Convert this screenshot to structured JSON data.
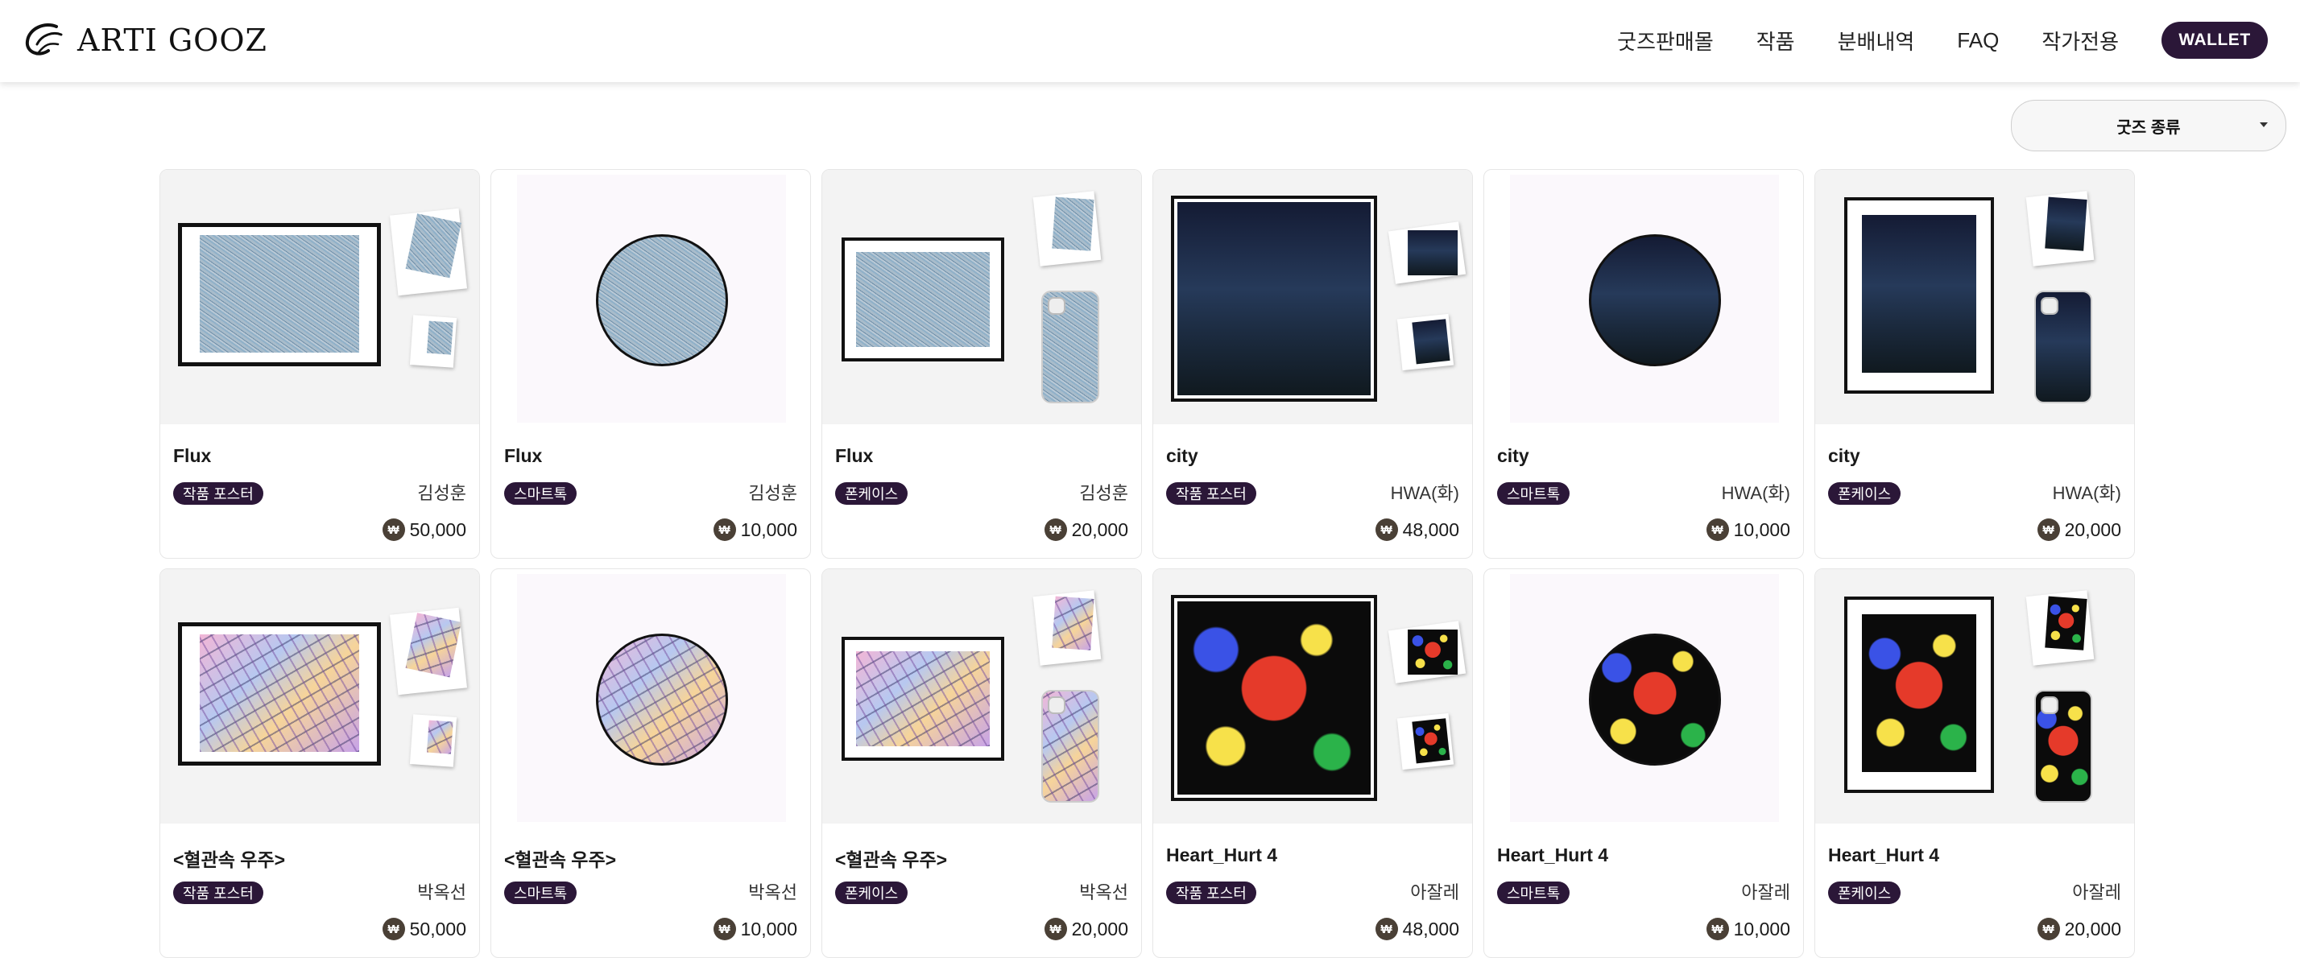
{
  "header": {
    "logo_text": "ARTI GOOZ",
    "nav": [
      "굿즈판매몰",
      "작품",
      "분배내역",
      "FAQ",
      "작가전용"
    ],
    "wallet_label": "WALLET"
  },
  "filter": {
    "selected": "굿즈 종류"
  },
  "currency_symbol": "₩",
  "products": [
    {
      "title": "Flux",
      "type": "작품 포스터",
      "artist": "김성훈",
      "price": "50,000",
      "layout": "poster",
      "art": "flux"
    },
    {
      "title": "Flux",
      "type": "스마트톡",
      "artist": "김성훈",
      "price": "10,000",
      "layout": "griptok",
      "art": "flux"
    },
    {
      "title": "Flux",
      "type": "폰케이스",
      "artist": "김성훈",
      "price": "20,000",
      "layout": "phonecase",
      "art": "flux"
    },
    {
      "title": "city",
      "type": "작품 포스터",
      "artist": "HWA(화)",
      "price": "48,000",
      "layout": "poster-square",
      "art": "city"
    },
    {
      "title": "city",
      "type": "스마트톡",
      "artist": "HWA(화)",
      "price": "10,000",
      "layout": "griptok",
      "art": "city"
    },
    {
      "title": "city",
      "type": "폰케이스",
      "artist": "HWA(화)",
      "price": "20,000",
      "layout": "phonecase-tall",
      "art": "city"
    },
    {
      "title": "<혈관속 우주>",
      "type": "작품 포스터",
      "artist": "박옥선",
      "price": "50,000",
      "layout": "poster",
      "art": "cosmos"
    },
    {
      "title": "<혈관속 우주>",
      "type": "스마트톡",
      "artist": "박옥선",
      "price": "10,000",
      "layout": "griptok",
      "art": "cosmos"
    },
    {
      "title": "<혈관속 우주>",
      "type": "폰케이스",
      "artist": "박옥선",
      "price": "20,000",
      "layout": "phonecase",
      "art": "cosmos"
    },
    {
      "title": "Heart_Hurt 4",
      "type": "작품 포스터",
      "artist": "아잘레",
      "price": "48,000",
      "layout": "poster-square",
      "art": "heart"
    },
    {
      "title": "Heart_Hurt 4",
      "type": "스마트톡",
      "artist": "아잘레",
      "price": "10,000",
      "layout": "griptok",
      "art": "heart"
    },
    {
      "title": "Heart_Hurt 4",
      "type": "폰케이스",
      "artist": "아잘레",
      "price": "20,000",
      "layout": "phonecase-tall",
      "art": "heart"
    }
  ],
  "colors": {
    "brand": "#2b1738",
    "won_icon": "#4a4036"
  },
  "icons": {
    "logo": "brand-swirl-icon",
    "filter_caret": "chevron-down-icon",
    "currency": "won-coin-icon"
  }
}
